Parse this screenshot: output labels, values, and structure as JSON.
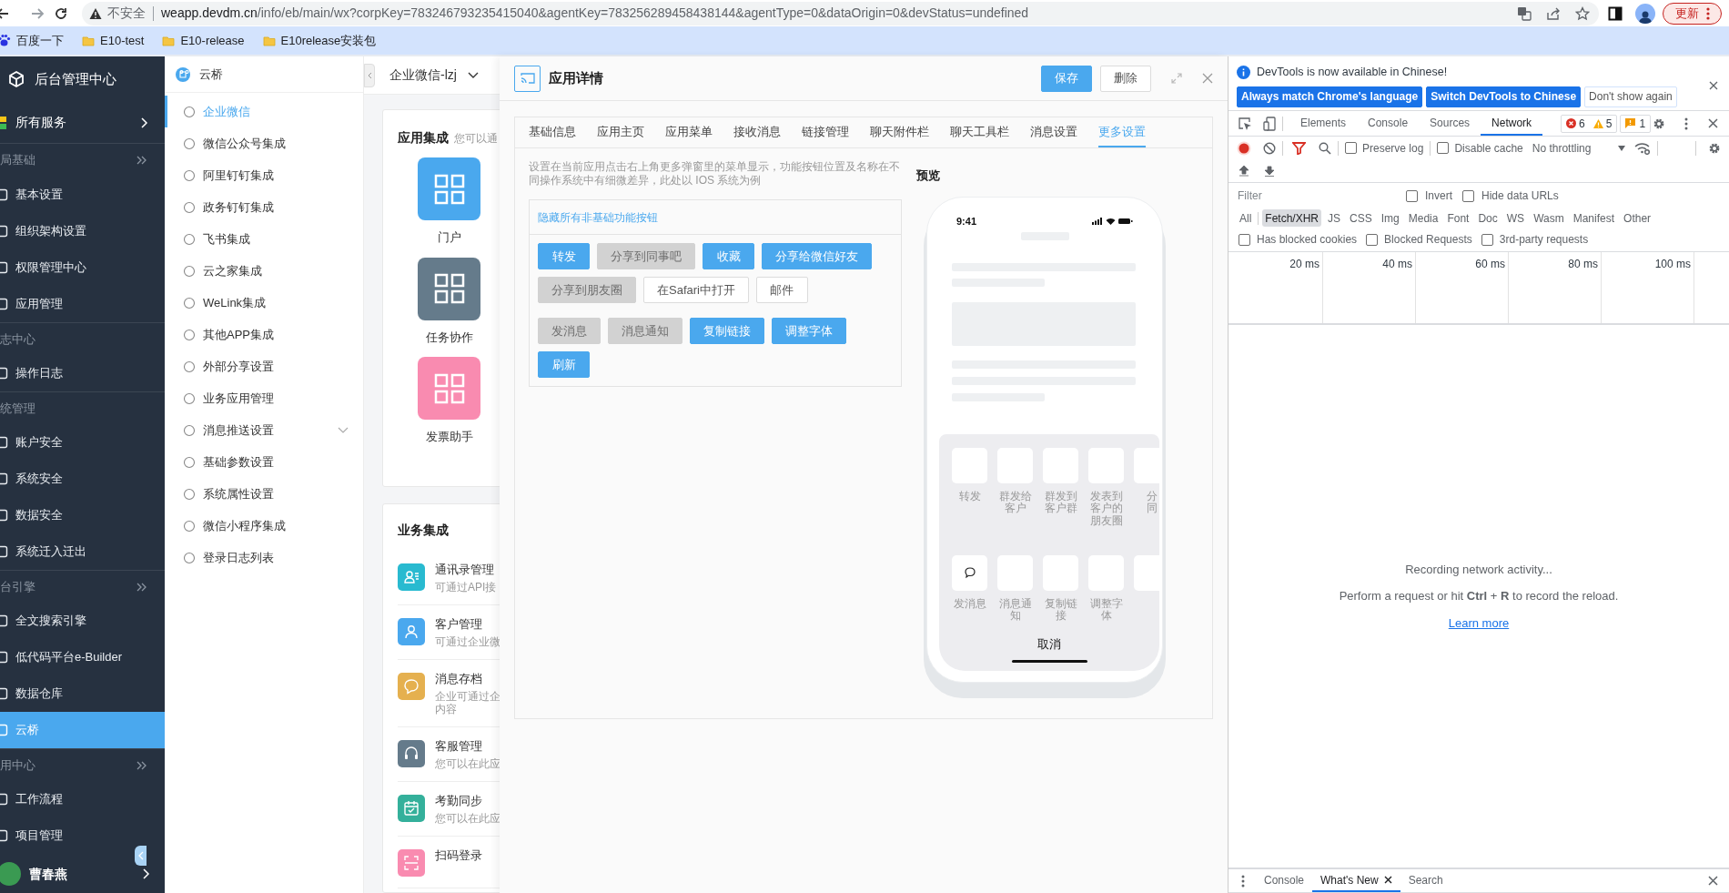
{
  "browser": {
    "security_label": "不安全",
    "url_host": "weapp.devdm.cn",
    "url_path": "/info/eb/main/wx?corpKey=783246793235415040&agentKey=783256289458438144&agentType=0&dataOrigin=0&devStatus=undefined",
    "update_button": "更新",
    "bookmarks": [
      {
        "label": "百度一下",
        "kind": "site"
      },
      {
        "label": "E10-test",
        "kind": "folder"
      },
      {
        "label": "E10-release",
        "kind": "folder"
      },
      {
        "label": "E10release安装包",
        "kind": "folder"
      }
    ]
  },
  "sidebar": {
    "title": "后台管理中心",
    "all_services": "所有服务",
    "sections": [
      {
        "label": "局基础",
        "collapsible": true,
        "items": [
          {
            "label": "基本设置",
            "selected": false
          },
          {
            "label": "组织架构设置",
            "selected": false
          },
          {
            "label": "权限管理中心",
            "selected": false
          },
          {
            "label": "应用管理",
            "selected": false
          }
        ]
      },
      {
        "label": "志中心",
        "collapsible": false,
        "items": [
          {
            "label": "操作日志",
            "selected": false
          }
        ]
      },
      {
        "label": "统管理",
        "collapsible": false,
        "items": [
          {
            "label": "账户安全",
            "selected": false
          },
          {
            "label": "系统安全",
            "selected": false
          },
          {
            "label": "数据安全",
            "selected": false
          },
          {
            "label": "系统迁入迁出",
            "selected": false
          }
        ]
      },
      {
        "label": "台引擎",
        "collapsible": true,
        "items": [
          {
            "label": "全文搜索引擎",
            "selected": false
          },
          {
            "label": "低代码平台e-Builder",
            "selected": false
          },
          {
            "label": "数据仓库",
            "selected": false
          },
          {
            "label": "云桥",
            "selected": true
          }
        ]
      },
      {
        "label": "用中心",
        "collapsible": true,
        "items": [
          {
            "label": "工作流程",
            "selected": false
          },
          {
            "label": "项目管理",
            "selected": false
          }
        ]
      }
    ],
    "user": {
      "name": "曹春燕"
    }
  },
  "module_nav": {
    "title": "云桥",
    "items": [
      {
        "label": "企业微信",
        "selected": true,
        "expandable": false
      },
      {
        "label": "微信公众号集成",
        "selected": false,
        "expandable": false
      },
      {
        "label": "阿里钉钉集成",
        "selected": false,
        "expandable": false
      },
      {
        "label": "政务钉钉集成",
        "selected": false,
        "expandable": false
      },
      {
        "label": "飞书集成",
        "selected": false,
        "expandable": false
      },
      {
        "label": "云之家集成",
        "selected": false,
        "expandable": false
      },
      {
        "label": "WeLink集成",
        "selected": false,
        "expandable": false
      },
      {
        "label": "其他APP集成",
        "selected": false,
        "expandable": false
      },
      {
        "label": "外部分享设置",
        "selected": false,
        "expandable": false
      },
      {
        "label": "业务应用管理",
        "selected": false,
        "expandable": false
      },
      {
        "label": "消息推送设置",
        "selected": false,
        "expandable": true
      },
      {
        "label": "基础参数设置",
        "selected": false,
        "expandable": false
      },
      {
        "label": "系统属性设置",
        "selected": false,
        "expandable": false
      },
      {
        "label": "微信小程序集成",
        "selected": false,
        "expandable": false
      },
      {
        "label": "登录日志列表",
        "selected": false,
        "expandable": false
      }
    ]
  },
  "workspace": {
    "selector": "企业微信-lzj",
    "app_section": {
      "title": "应用集成",
      "hint": "您可以通",
      "apps": [
        {
          "label": "门户",
          "color": "#4aa8ee"
        },
        {
          "label": "任务协作",
          "color": "#657b8b"
        },
        {
          "label": "发票助手",
          "color": "#f98bb0"
        }
      ]
    },
    "business_section": {
      "title": "业务集成",
      "items": [
        {
          "title": "通讯录管理",
          "desc_lines": [
            "可通过API接"
          ],
          "color": "#29bad0"
        },
        {
          "title": "客户管理",
          "desc_lines": [
            "可通过企业微"
          ],
          "color": "#4aa8ee"
        },
        {
          "title": "消息存档",
          "desc_lines": [
            "企业可通过企",
            "内容"
          ],
          "color": "#e5b04f"
        },
        {
          "title": "客服管理",
          "desc_lines": [
            "您可以在此应"
          ],
          "color": "#657b8b"
        },
        {
          "title": "考勤同步",
          "desc_lines": [
            "您可以在此应"
          ],
          "color": "#34b09b"
        },
        {
          "title": "扫码登录",
          "color": "#f98bb0"
        }
      ]
    }
  },
  "dialog": {
    "title": "应用详情",
    "actions": [
      {
        "label": "保存",
        "kind": "primary"
      },
      {
        "label": "删除",
        "kind": "default"
      }
    ],
    "tabs": [
      {
        "label": "基础信息",
        "selected": false
      },
      {
        "label": "应用主页",
        "selected": false
      },
      {
        "label": "应用菜单",
        "selected": false
      },
      {
        "label": "接收消息",
        "selected": false
      },
      {
        "label": "链接管理",
        "selected": false
      },
      {
        "label": "聊天附件栏",
        "selected": false
      },
      {
        "label": "聊天工具栏",
        "selected": false
      },
      {
        "label": "消息设置",
        "selected": false
      },
      {
        "label": "更多设置",
        "selected": true
      }
    ],
    "description": "设置在当前应用点击右上角更多弹窗里的菜单显示，功能按钮位置及名称在不同操作系统中有细微差异，此处以 IOS 系统为例",
    "hide_all_link": "隐藏所有非基础功能按钮",
    "button_groups": [
      [
        {
          "label": "转发",
          "kind": "active"
        },
        {
          "label": "分享到同事吧",
          "kind": "inactive"
        },
        {
          "label": "收藏",
          "kind": "active"
        },
        {
          "label": "分享给微信好友",
          "kind": "active"
        },
        {
          "label": "分享到朋友圈",
          "kind": "inactive"
        },
        {
          "label": "在Safari中打开",
          "kind": "plain"
        },
        {
          "label": "邮件",
          "kind": "plain"
        }
      ],
      [
        {
          "label": "发消息",
          "kind": "inactive"
        },
        {
          "label": "消息通知",
          "kind": "inactive"
        },
        {
          "label": "复制链接",
          "kind": "active"
        },
        {
          "label": "调整字体",
          "kind": "active"
        },
        {
          "label": "刷新",
          "kind": "active"
        }
      ]
    ],
    "preview": {
      "title": "预览",
      "time": "9:41",
      "cancel": "取消",
      "rows": [
        [
          {
            "lines": [
              "转发"
            ],
            "has_icon": false
          },
          {
            "lines": [
              "群发给",
              "客户"
            ],
            "has_icon": false
          },
          {
            "lines": [
              "群发到",
              "客户群"
            ],
            "has_icon": false
          },
          {
            "lines": [
              "发表到",
              "客户的",
              "朋友圈"
            ],
            "has_icon": false
          },
          {
            "lines": [
              "分",
              "同"
            ],
            "has_icon": false
          }
        ],
        [
          {
            "lines": [
              "发消息"
            ],
            "has_icon": true
          },
          {
            "lines": [
              "消息通",
              "知"
            ],
            "has_icon": false
          },
          {
            "lines": [
              "复制链",
              "接"
            ],
            "has_icon": false
          },
          {
            "lines": [
              "调整字",
              "体"
            ],
            "has_icon": false
          },
          {
            "has_icon": false
          }
        ]
      ]
    }
  },
  "devtools": {
    "infobar": {
      "message": "DevTools is now available in Chinese!",
      "buttons": [
        {
          "label": "Always match Chrome's language",
          "kind": "primary"
        },
        {
          "label": "Switch DevTools to Chinese",
          "kind": "primary"
        },
        {
          "label": "Don't show again",
          "kind": "plain"
        }
      ]
    },
    "tabs": [
      {
        "label": "Elements",
        "selected": false
      },
      {
        "label": "Console",
        "selected": false
      },
      {
        "label": "Sources",
        "selected": false
      },
      {
        "label": "Network",
        "selected": true
      }
    ],
    "errors": "6",
    "warnings": "5",
    "issues": "1",
    "preserve_log": {
      "label": "Preserve log",
      "checked": false
    },
    "disable_cache": {
      "label": "Disable cache",
      "checked": false
    },
    "throttling": "No throttling",
    "filter": {
      "placeholder": "Filter"
    },
    "filter_options": [
      {
        "label": "Invert",
        "checked": false
      },
      {
        "label": "Hide data URLs",
        "checked": false
      }
    ],
    "types": [
      {
        "label": "All",
        "selected": false
      },
      {
        "label": "Fetch/XHR",
        "selected": true
      },
      {
        "label": "JS",
        "selected": false
      },
      {
        "label": "CSS",
        "selected": false
      },
      {
        "label": "Img",
        "selected": false
      },
      {
        "label": "Media",
        "selected": false
      },
      {
        "label": "Font",
        "selected": false
      },
      {
        "label": "Doc",
        "selected": false
      },
      {
        "label": "WS",
        "selected": false
      },
      {
        "label": "Wasm",
        "selected": false
      },
      {
        "label": "Manifest",
        "selected": false
      },
      {
        "label": "Other",
        "selected": false
      }
    ],
    "request_options": [
      {
        "label": "Has blocked cookies",
        "checked": false
      },
      {
        "label": "Blocked Requests",
        "checked": false
      },
      {
        "label": "3rd-party requests",
        "checked": false
      }
    ],
    "timeline_ticks": [
      "20 ms",
      "40 ms",
      "60 ms",
      "80 ms",
      "100 ms"
    ],
    "empty": {
      "title": "Recording network activity...",
      "hint": "Perform a request or hit **Ctrl** + **R** to record the reload.",
      "link": "Learn more"
    },
    "drawer_tabs": [
      {
        "label": "Console",
        "selected": false,
        "closable": false
      },
      {
        "label": "What's New",
        "selected": true,
        "closable": true
      },
      {
        "label": "Search",
        "selected": false,
        "closable": false
      }
    ]
  }
}
